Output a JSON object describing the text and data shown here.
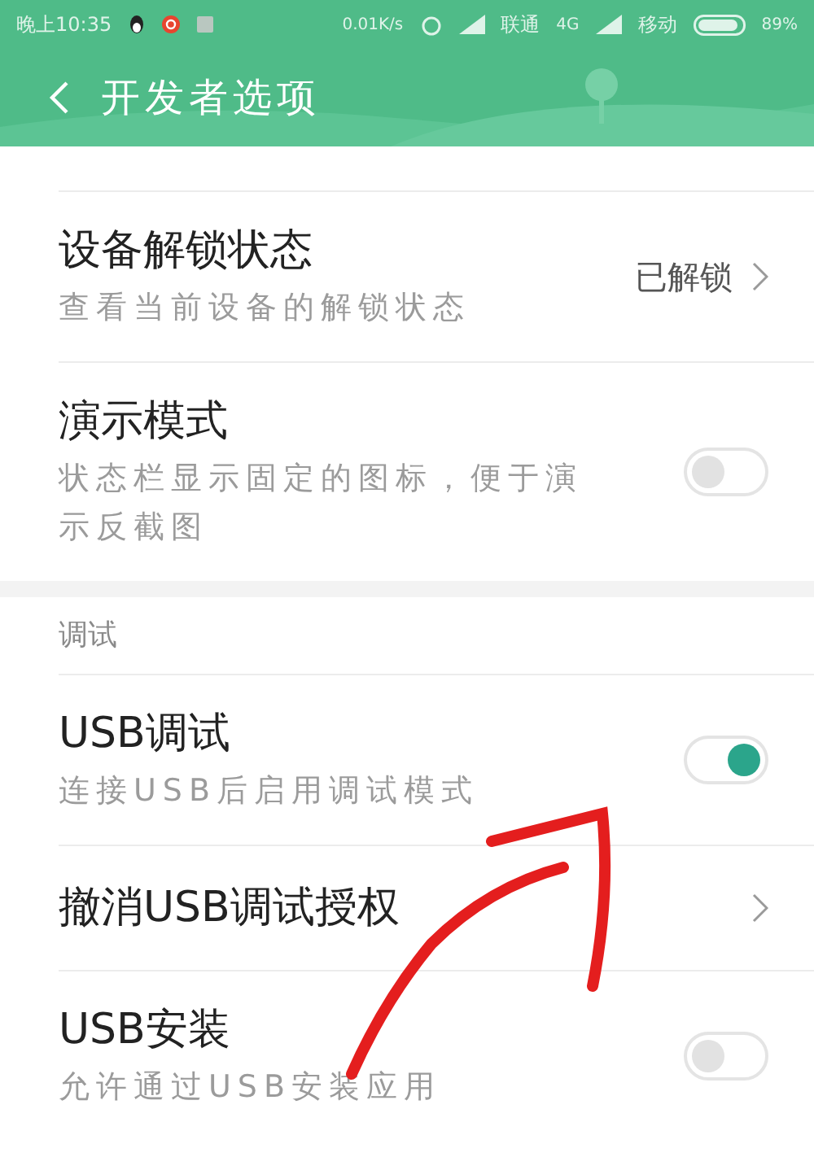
{
  "status_bar": {
    "time": "晚上10:35",
    "net_speed": "0.01K/s",
    "carrier_1": "联通",
    "network": "4G",
    "carrier_2": "移动",
    "battery": "89%"
  },
  "header": {
    "title": "开发者选项"
  },
  "sections": [
    {
      "items": [
        {
          "kind": "link",
          "title": "设备解锁状态",
          "subtitle": "查看当前设备的解锁状态",
          "value": "已解锁"
        },
        {
          "kind": "toggle",
          "title": "演示模式",
          "subtitle": "状态栏显示固定的图标，便于演示反截图",
          "on": false
        }
      ]
    },
    {
      "title": "调试",
      "items": [
        {
          "kind": "toggle",
          "title": "USB调试",
          "subtitle": "连接USB后启用调试模式",
          "on": true
        },
        {
          "kind": "link",
          "title": "撤消USB调试授权"
        },
        {
          "kind": "toggle",
          "title": "USB安装",
          "subtitle": "允许通过USB安装应用",
          "on": false
        }
      ]
    }
  ]
}
